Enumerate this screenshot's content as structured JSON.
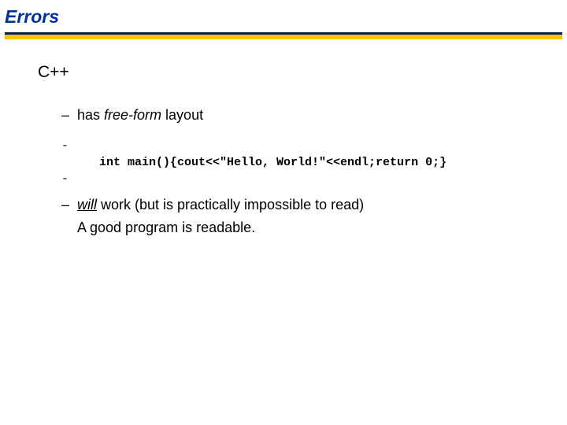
{
  "title": "Errors",
  "heading": "C++",
  "bullets": {
    "b1_prefix": "has ",
    "b1_italic": "free-form",
    "b1_suffix": " layout",
    "code": "int main(){cout<<\"Hello, World!\"<<endl;return 0;}",
    "b2_under": "will",
    "b2_rest": " work (but is practically impossible to read)",
    "b2_sub": "A good program is readable."
  },
  "dash": "–",
  "code_dash": "-"
}
